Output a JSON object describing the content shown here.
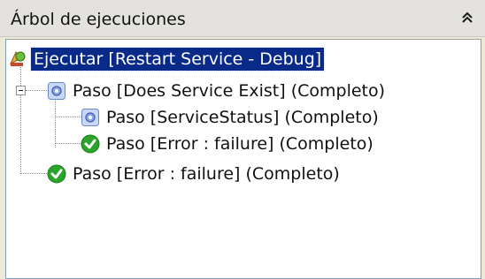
{
  "panel": {
    "title": "Árbol de ejecuciones",
    "collapse_icon": "double-chevron-up-icon"
  },
  "tree": {
    "root": {
      "label": "Ejecutar [Restart Service - Debug]",
      "icon": "run-script-icon",
      "selected": true
    },
    "nodes": [
      {
        "label": "Paso [Does Service Exist] (Completo)",
        "icon": "gear-step-icon",
        "expanded": true
      },
      {
        "label": "Paso [ServiceStatus] (Completo)",
        "icon": "gear-step-icon"
      },
      {
        "label": "Paso [Error : failure] (Completo)",
        "icon": "success-check-icon"
      },
      {
        "label": "Paso [Error : failure] (Completo)",
        "icon": "success-check-icon"
      }
    ]
  },
  "colors": {
    "selection": "#0a2a8a",
    "success": "#2aa52a",
    "gear_icon_bg": "#c9d8f6"
  }
}
